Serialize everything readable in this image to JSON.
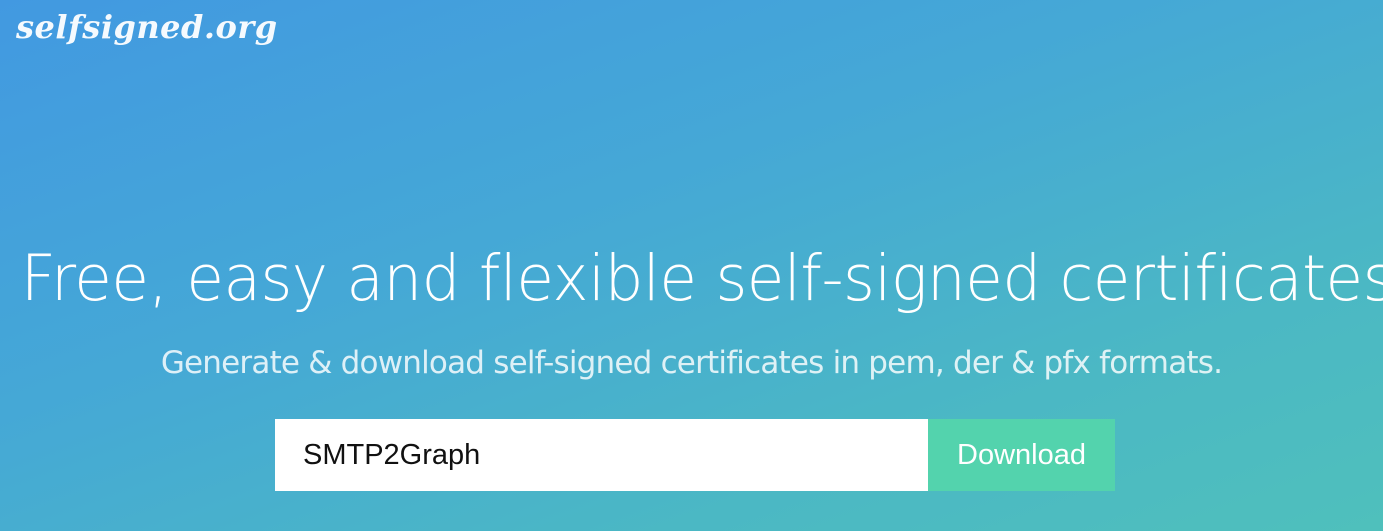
{
  "header": {
    "logo_text": "selfsigned.org"
  },
  "hero": {
    "title": "Free, easy and flexible self-signed certificates",
    "subtitle": "Generate & download self-signed certificates in pem, der & pfx formats."
  },
  "form": {
    "input_value": "SMTP2Graph",
    "download_label": "Download"
  },
  "colors": {
    "gradient_start": "#4299e1",
    "gradient_end": "#4fc0bc",
    "button": "#53d3ad"
  }
}
